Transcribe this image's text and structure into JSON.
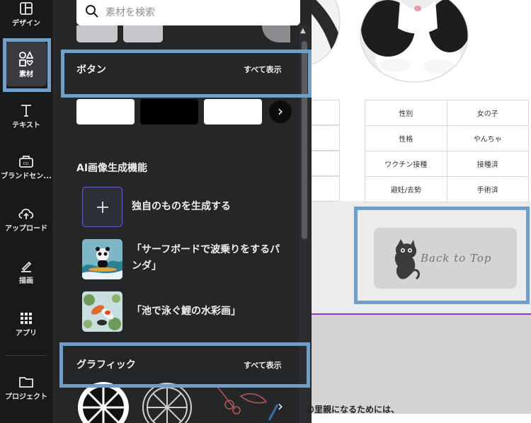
{
  "rail": {
    "design": "デザイン",
    "elements": "素材",
    "text": "テキスト",
    "brand": "ブランドセン...",
    "upload": "アップロード",
    "draw": "描画",
    "apps": "アプリ",
    "projects": "プロジェクト"
  },
  "panel": {
    "search_placeholder": "素材を検索",
    "buttons_title": "ボタン",
    "see_all": "すべて表示",
    "ai_title": "AI画像生成機能",
    "ai_items": [
      "独自のものを生成する",
      "「サーフボードで波乗りをするパンダ」",
      "「池で泳ぐ鯉の水彩画」"
    ],
    "graphics_title": "グラフィック",
    "graphics_see_all": "すべて表示"
  },
  "canvas": {
    "table": [
      [
        "性別",
        "女の子"
      ],
      [
        "性格",
        "やんちゃ"
      ],
      [
        "ワクチン接種",
        "接種済"
      ],
      [
        "避妊/去勢",
        "手術済"
      ]
    ],
    "back_to_top": "Back to Top",
    "bottom_text": "の里親になるためには、"
  },
  "colors": {
    "rail_bg": "#18191b",
    "panel_bg": "#252627",
    "highlight": "#6f9ec9",
    "accent_line": "#8e3bc9"
  }
}
